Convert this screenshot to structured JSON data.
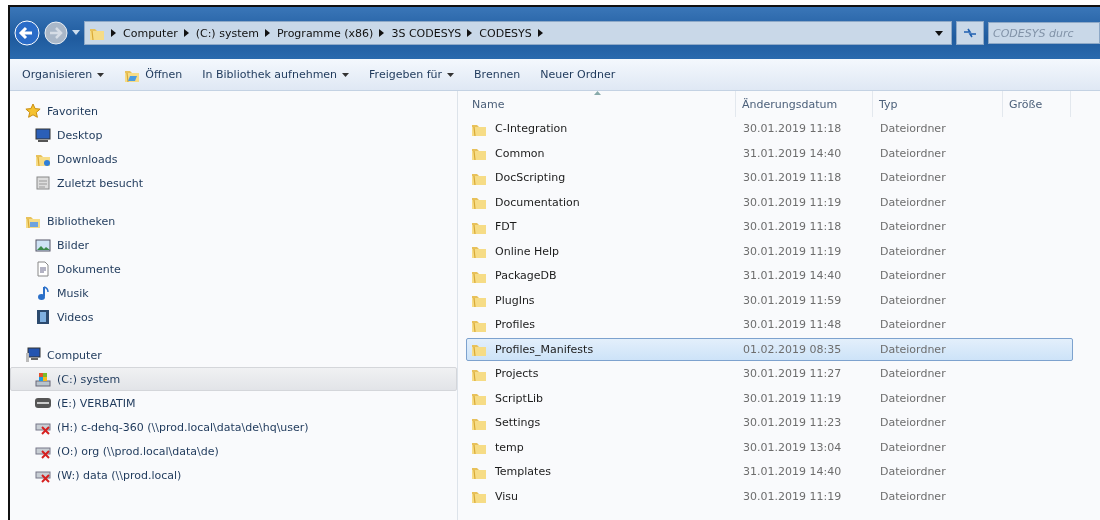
{
  "address_bar": {
    "crumbs": [
      "Computer",
      "(C:) system",
      "Programme (x86)",
      "3S CODESYS",
      "CODESYS"
    ]
  },
  "search": {
    "placeholder": "CODESYS durc"
  },
  "toolbar": [
    {
      "label": "Organisieren",
      "dropdown": true,
      "icon": false
    },
    {
      "label": "Öffnen",
      "dropdown": false,
      "icon": true
    },
    {
      "label": "In Bibliothek aufnehmen",
      "dropdown": true,
      "icon": false
    },
    {
      "label": "Freigeben für",
      "dropdown": true,
      "icon": false
    },
    {
      "label": "Brennen",
      "dropdown": false,
      "icon": false
    },
    {
      "label": "Neuer Ordner",
      "dropdown": false,
      "icon": false
    }
  ],
  "sidebar": {
    "groups": [
      {
        "label": "Favoriten",
        "kind": "star",
        "selected": false,
        "children": [
          {
            "label": "Desktop",
            "kind": "desktop",
            "selected": false
          },
          {
            "label": "Downloads",
            "kind": "downloads",
            "selected": false
          },
          {
            "label": "Zuletzt besucht",
            "kind": "recent",
            "selected": false
          }
        ]
      },
      {
        "label": "Bibliotheken",
        "kind": "library",
        "selected": false,
        "children": [
          {
            "label": "Bilder",
            "kind": "pictures",
            "selected": false
          },
          {
            "label": "Dokumente",
            "kind": "documents",
            "selected": false
          },
          {
            "label": "Musik",
            "kind": "music",
            "selected": false
          },
          {
            "label": "Videos",
            "kind": "videos",
            "selected": false
          }
        ]
      },
      {
        "label": "Computer",
        "kind": "computer",
        "selected": false,
        "children": [
          {
            "label": "(C:) system",
            "kind": "system-drive",
            "selected": true
          },
          {
            "label": "(E:) VERBATIM",
            "kind": "drive",
            "selected": false
          },
          {
            "label": "(H:) c-dehq-360 (\\\\prod.local\\data\\de\\hq\\user)",
            "kind": "network-drive",
            "selected": false
          },
          {
            "label": "(O:) org (\\\\prod.local\\data\\de)",
            "kind": "network-drive",
            "selected": false
          },
          {
            "label": "(W:) data (\\\\prod.local)",
            "kind": "network-drive",
            "selected": false
          }
        ]
      }
    ]
  },
  "table": {
    "columns": [
      "Name",
      "Änderungsdatum",
      "Typ",
      "Größe"
    ],
    "rows": [
      {
        "name": "C-Integration",
        "date": "30.01.2019 11:18",
        "type": "Dateiordner",
        "selected": false
      },
      {
        "name": "Common",
        "date": "31.01.2019 14:40",
        "type": "Dateiordner",
        "selected": false
      },
      {
        "name": "DocScripting",
        "date": "30.01.2019 11:18",
        "type": "Dateiordner",
        "selected": false
      },
      {
        "name": "Documentation",
        "date": "30.01.2019 11:19",
        "type": "Dateiordner",
        "selected": false
      },
      {
        "name": "FDT",
        "date": "30.01.2019 11:18",
        "type": "Dateiordner",
        "selected": false
      },
      {
        "name": "Online Help",
        "date": "30.01.2019 11:19",
        "type": "Dateiordner",
        "selected": false
      },
      {
        "name": "PackageDB",
        "date": "31.01.2019 14:40",
        "type": "Dateiordner",
        "selected": false
      },
      {
        "name": "PlugIns",
        "date": "30.01.2019 11:59",
        "type": "Dateiordner",
        "selected": false
      },
      {
        "name": "Profiles",
        "date": "30.01.2019 11:48",
        "type": "Dateiordner",
        "selected": false
      },
      {
        "name": "Profiles_Manifests",
        "date": "01.02.2019 08:35",
        "type": "Dateiordner",
        "selected": true
      },
      {
        "name": "Projects",
        "date": "30.01.2019 11:27",
        "type": "Dateiordner",
        "selected": false
      },
      {
        "name": "ScriptLib",
        "date": "30.01.2019 11:19",
        "type": "Dateiordner",
        "selected": false
      },
      {
        "name": "Settings",
        "date": "30.01.2019 11:23",
        "type": "Dateiordner",
        "selected": false
      },
      {
        "name": "temp",
        "date": "30.01.2019 13:04",
        "type": "Dateiordner",
        "selected": false
      },
      {
        "name": "Templates",
        "date": "31.01.2019 14:40",
        "type": "Dateiordner",
        "selected": false
      },
      {
        "name": "Visu",
        "date": "30.01.2019 11:19",
        "type": "Dateiordner",
        "selected": false
      }
    ]
  }
}
